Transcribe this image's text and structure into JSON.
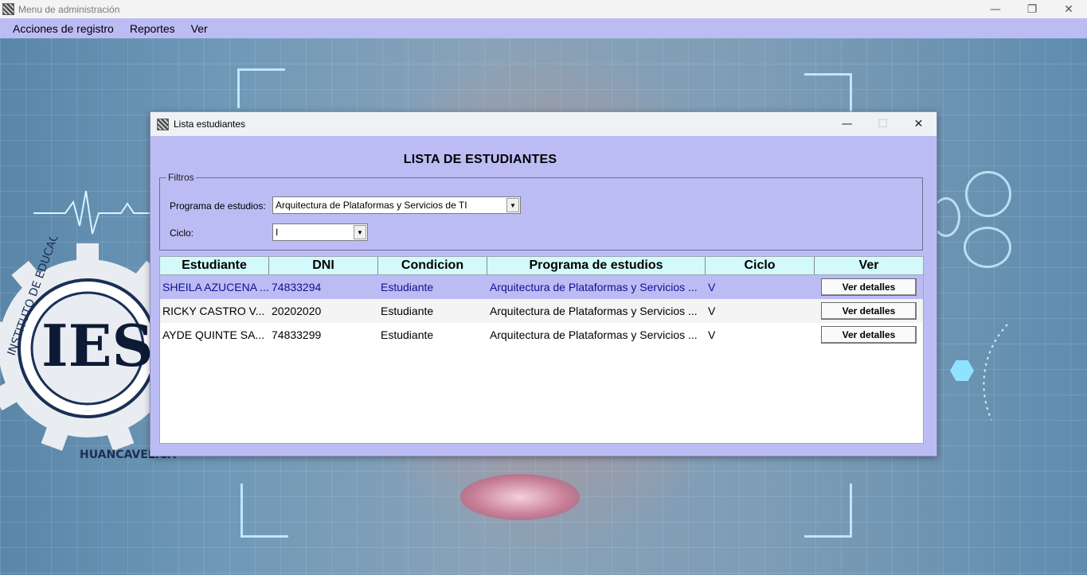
{
  "main_window": {
    "title": "Menu de administración",
    "controls": {
      "minimize": "—",
      "restore": "❐",
      "close": "✕"
    }
  },
  "menubar": {
    "items": [
      "Acciones de registro",
      "Reportes",
      "Ver"
    ]
  },
  "dialog": {
    "title": "Lista estudiantes",
    "controls": {
      "minimize": "—",
      "maximize": "☐",
      "close": "✕"
    },
    "heading": "LISTA DE ESTUDIANTES",
    "filters": {
      "legend": "Filtros",
      "program_label": "Programa de estudios:",
      "program_value": "Arquitectura de Plataformas y Servicios de TI",
      "cycle_label": "Ciclo:",
      "cycle_value": "I"
    },
    "table": {
      "columns": [
        "Estudiante",
        "DNI",
        "Condicion",
        "Programa de estudios",
        "Ciclo",
        "Ver"
      ],
      "rows": [
        {
          "estudiante": "SHEILA AZUCENA ...",
          "dni": "74833294",
          "condicion": "Estudiante",
          "programa": "Arquitectura de Plataformas y Servicios ...",
          "ciclo": "V",
          "ver": "Ver detalles"
        },
        {
          "estudiante": "RICKY CASTRO V...",
          "dni": "20202020",
          "condicion": "Estudiante",
          "programa": "Arquitectura de Plataformas y Servicios ...",
          "ciclo": "V",
          "ver": "Ver detalles"
        },
        {
          "estudiante": "AYDE QUINTE SA...",
          "dni": "74833299",
          "condicion": "Estudiante",
          "programa": "Arquitectura de Plataformas y Servicios ...",
          "ciclo": "V",
          "ver": "Ver detalles"
        }
      ]
    }
  },
  "background": {
    "logo_letters": "IESTP",
    "logo_ring_text": "INSTITUTO DE EDUCACION SUPERIOR",
    "logo_bottom_text": "HUANCAVELICA"
  },
  "colors": {
    "accent": "#bcbcf5",
    "table_header": "#d2fafa",
    "selected_text": "#101090"
  }
}
